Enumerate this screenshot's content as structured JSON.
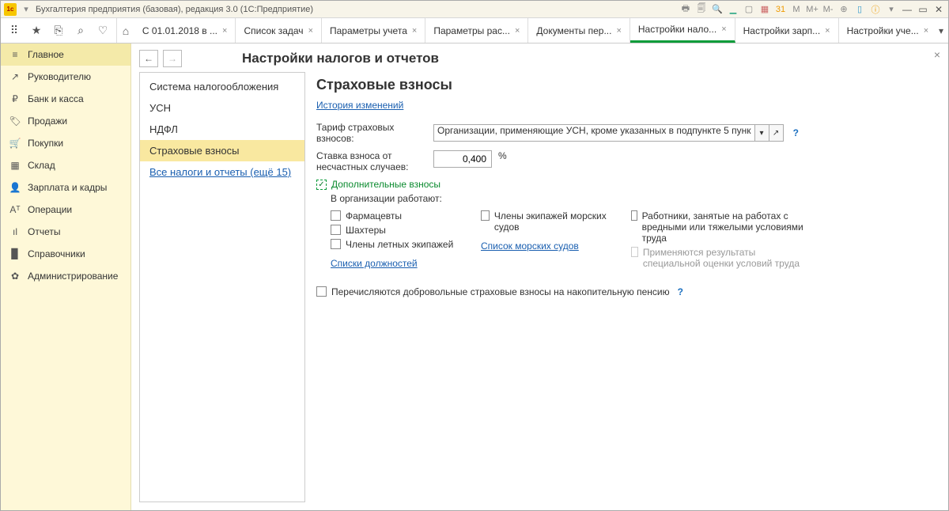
{
  "window": {
    "title": "Бухгалтерия предприятия (базовая), редакция 3.0  (1С:Предприятие)"
  },
  "tabs": {
    "items": [
      {
        "label": "С 01.01.2018 в ..."
      },
      {
        "label": "Список задач"
      },
      {
        "label": "Параметры учета"
      },
      {
        "label": "Параметры рас..."
      },
      {
        "label": "Документы пер..."
      },
      {
        "label": "Настройки нало..."
      },
      {
        "label": "Настройки зарп..."
      },
      {
        "label": "Настройки уче..."
      }
    ]
  },
  "sidebar": {
    "items": [
      {
        "label": "Главное",
        "icon": "≡"
      },
      {
        "label": "Руководителю",
        "icon": "↗"
      },
      {
        "label": "Банк и касса",
        "icon": "₽"
      },
      {
        "label": "Продажи",
        "icon": "🏷"
      },
      {
        "label": "Покупки",
        "icon": "🛒"
      },
      {
        "label": "Склад",
        "icon": "▦"
      },
      {
        "label": "Зарплата и кадры",
        "icon": "👤"
      },
      {
        "label": "Операции",
        "icon": "Aᵀ"
      },
      {
        "label": "Отчеты",
        "icon": "ıl"
      },
      {
        "label": "Справочники",
        "icon": "▉"
      },
      {
        "label": "Администрирование",
        "icon": "✿"
      }
    ]
  },
  "page": {
    "title": "Настройки налогов и отчетов",
    "tree": {
      "items": [
        {
          "label": "Система налогообложения"
        },
        {
          "label": "УСН"
        },
        {
          "label": "НДФЛ"
        },
        {
          "label": "Страховые взносы"
        }
      ],
      "more": "Все налоги и отчеты (ещё 15)"
    },
    "form": {
      "heading": "Страховые взносы",
      "history": "История изменений",
      "tariff_label": "Тариф страховых взносов:",
      "tariff_value": "Организации, применяющие УСН, кроме указанных в подпункте 5 пунк",
      "accident_label": "Ставка взноса от несчастных случаев:",
      "accident_value": "0,400",
      "pct": "%",
      "addl": "Дополнительные взносы",
      "org_work": "В организации работают:",
      "col1": {
        "c1": "Фармацевты",
        "c2": "Шахтеры",
        "c3": "Члены летных экипажей",
        "link": "Списки должностей"
      },
      "col2": {
        "c1": "Члены экипажей морских судов",
        "link": "Список морских судов"
      },
      "col3": {
        "c1": "Работники, занятые на работах с вредными или тяжелыми условиями труда",
        "c2": "Применяются результаты специальной оценки условий труда"
      },
      "voluntary": "Перечисляются добровольные страховые взносы на накопительную пенсию",
      "q": "?"
    }
  }
}
